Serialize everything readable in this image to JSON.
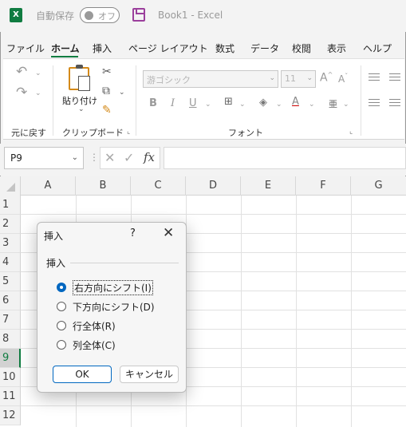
{
  "titlebar": {
    "logo_text": "X",
    "autosave_label": "自動保存",
    "autosave_state": "オフ",
    "doc_title": "Book1  -  Excel"
  },
  "tabs": [
    "ファイル",
    "ホーム",
    "挿入",
    "ページ レイアウト",
    "数式",
    "データ",
    "校閲",
    "表示",
    "ヘルプ"
  ],
  "ribbon": {
    "undo_group_label": "元に戻す",
    "clipboard_group_label": "クリップボード",
    "paste_label": "貼り付け",
    "font_group_label": "フォント",
    "font_name": "游ゴシック",
    "font_size": "11",
    "bold": "B",
    "italic": "I",
    "underline": "U",
    "font_color_letter": "A",
    "grow_font": "A",
    "shrink_font": "A",
    "furigana": "亜"
  },
  "formula_bar": {
    "name_box": "P9",
    "fx": "fx",
    "value": ""
  },
  "grid": {
    "columns": [
      "A",
      "B",
      "C",
      "D",
      "E",
      "F",
      "G"
    ],
    "rows": [
      "1",
      "2",
      "3",
      "4",
      "5",
      "6",
      "7",
      "8",
      "9",
      "10",
      "11",
      "12"
    ],
    "selected_row": "9"
  },
  "dialog": {
    "title": "挿入",
    "help": "?",
    "close": "✕",
    "group_label": "挿入",
    "options": [
      {
        "label": "右方向にシフト(I)",
        "checked": true
      },
      {
        "label": "下方向にシフト(D)",
        "checked": false
      },
      {
        "label": "行全体(R)",
        "checked": false
      },
      {
        "label": "列全体(C)",
        "checked": false
      }
    ],
    "ok_label": "OK",
    "cancel_label": "キャンセル"
  },
  "colors": {
    "excel_green": "#107c41",
    "radio_blue": "#0067c0",
    "save_purple": "#9b3f9c"
  }
}
